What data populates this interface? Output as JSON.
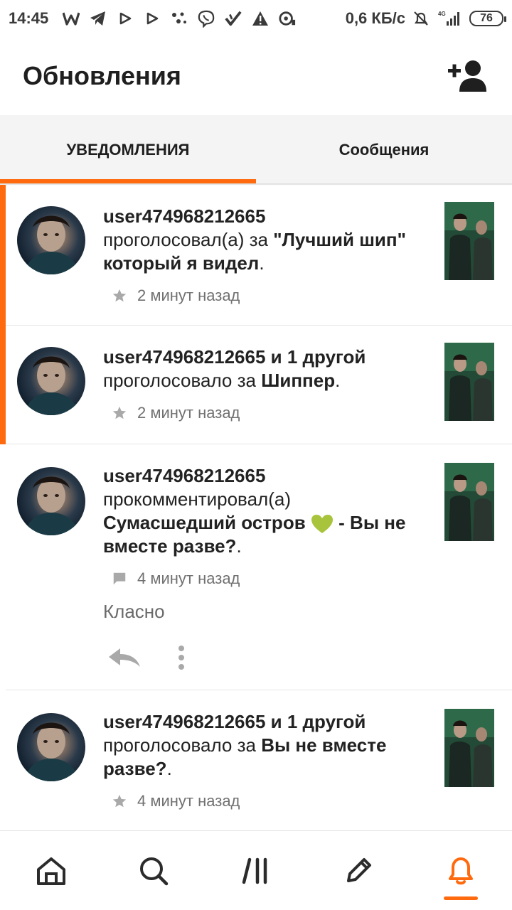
{
  "statusbar": {
    "time": "14:45",
    "speed": "0,6 КБ/с",
    "network": "4G",
    "battery": "76",
    "icons": [
      "w-icon",
      "telegram-icon",
      "play-icon",
      "play-icon",
      "dots-icon",
      "viber-icon",
      "check-icon",
      "warning-icon",
      "fan-icon"
    ]
  },
  "header": {
    "title": "Обновления",
    "action_icon": "add-friend-icon"
  },
  "tabs": [
    {
      "label": "УВЕДОМЛЕНИЯ",
      "active": true
    },
    {
      "label": "Сообщения",
      "active": false
    }
  ],
  "notifications": [
    {
      "user": "user474968212665",
      "action": "проголосовал(а) за",
      "target": "\"Лучший шип\" который я видел",
      "end": ".",
      "time": "2 минут назад",
      "icon": "star-icon",
      "unread": true
    },
    {
      "user": "user474968212665 и 1 другой",
      "action": "проголосовало за",
      "target": "Шиппер",
      "end": ".",
      "time": "2 минут назад",
      "icon": "star-icon",
      "unread": true
    },
    {
      "user": "user474968212665",
      "action": "прокомментировал(а)",
      "target_part1": "Сумасшедший остров",
      "target_part2": "- Вы не вместе разве?",
      "end": ".",
      "time": "4 минут назад",
      "icon": "comment-icon",
      "comment": "Класно",
      "unread": false
    },
    {
      "user": "user474968212665 и 1 другой",
      "action": "проголосовало за",
      "target": "Вы не вместе разве?",
      "end": ".",
      "time": "4 минут назад",
      "icon": "star-icon",
      "unread": false
    }
  ],
  "bottomnav": [
    {
      "icon": "home-icon",
      "active": false
    },
    {
      "icon": "search-icon",
      "active": false
    },
    {
      "icon": "library-icon",
      "active": false
    },
    {
      "icon": "pencil-icon",
      "active": false
    },
    {
      "icon": "bell-icon",
      "active": true
    }
  ],
  "colors": {
    "accent": "#ff6a0e",
    "text": "#1f1f1f",
    "muted": "#707070",
    "heart": "#a8c43c"
  }
}
